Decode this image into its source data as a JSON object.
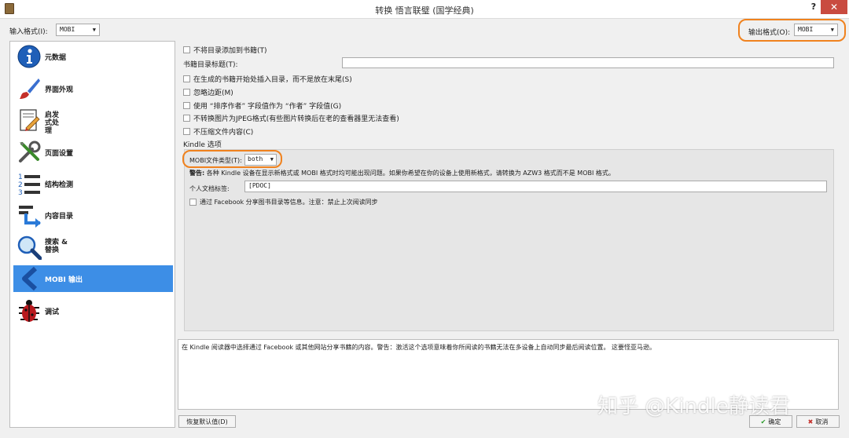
{
  "window": {
    "title": "转换 悟言联璧 (国学经典)",
    "help_label": "?",
    "close_label": "✕"
  },
  "input_format": {
    "label": "输入格式(I):",
    "value": "MOBI"
  },
  "output_format": {
    "label": "输出格式(O):",
    "value": "MOBI"
  },
  "sidebar": {
    "items": [
      {
        "label": "元数据",
        "icon": "info-icon"
      },
      {
        "label": "界面外观",
        "icon": "paintbrush-icon"
      },
      {
        "label": "启发式处理",
        "icon": "heuristics-icon"
      },
      {
        "label": "页面设置",
        "icon": "tools-icon"
      },
      {
        "label": "结构检测",
        "icon": "numbered-list-icon"
      },
      {
        "label": "内容目录",
        "icon": "toc-icon"
      },
      {
        "label": "搜索 & 替换",
        "icon": "magnifier-icon"
      },
      {
        "label": "MOBI 输出",
        "icon": "chevron-left-icon",
        "active": true
      },
      {
        "label": "调试",
        "icon": "bug-icon"
      }
    ]
  },
  "options": {
    "no_toc_in_book": "不将目录添加到书籍(T)",
    "toc_title_label": "书籍目录标题(T):",
    "toc_title_value": "",
    "toc_at_start": "在生成的书籍开始处插入目录，而不是放在末尾(S)",
    "ignore_margins": "忽略边距(M)",
    "author_sort": "使用 “排序作者” 字段值作为 “作者” 字段值(G)",
    "no_jpeg": "不转换图片为JPEG格式(有些图片转换后在老的查看器里无法查看)",
    "no_inline_toc": "不压缩文件内容(C)"
  },
  "kindle": {
    "section_title": "Kindle 选项",
    "file_type_label": "MOBI文件类型(T):",
    "file_type_value": "both",
    "warning_bold": "警告:",
    "warning_text": "各种 Kindle 设备在显示新格式或 MOBI 格式时均可能出现问题。如果你希望在你的设备上使用新格式，请转换为 AZW3 格式而不是 MOBI 格式。",
    "personal_doc_label": "个人文档标签:",
    "personal_doc_value": "[PDOC]",
    "share_facebook": "通过 Facebook 分享图书目录等信息。注意：禁止上次阅读同步"
  },
  "description": "在 Kindle 阅读器中选择通过 Facebook 或其他网站分享书籍的内容。警告：激活这个选项意味着你所阅读的书籍无法在多设备上自动同步最后阅读位置。 这要怪亚马逊。",
  "buttons": {
    "restore_defaults": "恢复默认值(D)",
    "ok": "确定",
    "cancel": "取消"
  },
  "watermark": "知乎 @Kindle静读君",
  "colors": {
    "accent": "#3d8ee6",
    "highlight": "#f0821e",
    "close": "#c94b40"
  }
}
